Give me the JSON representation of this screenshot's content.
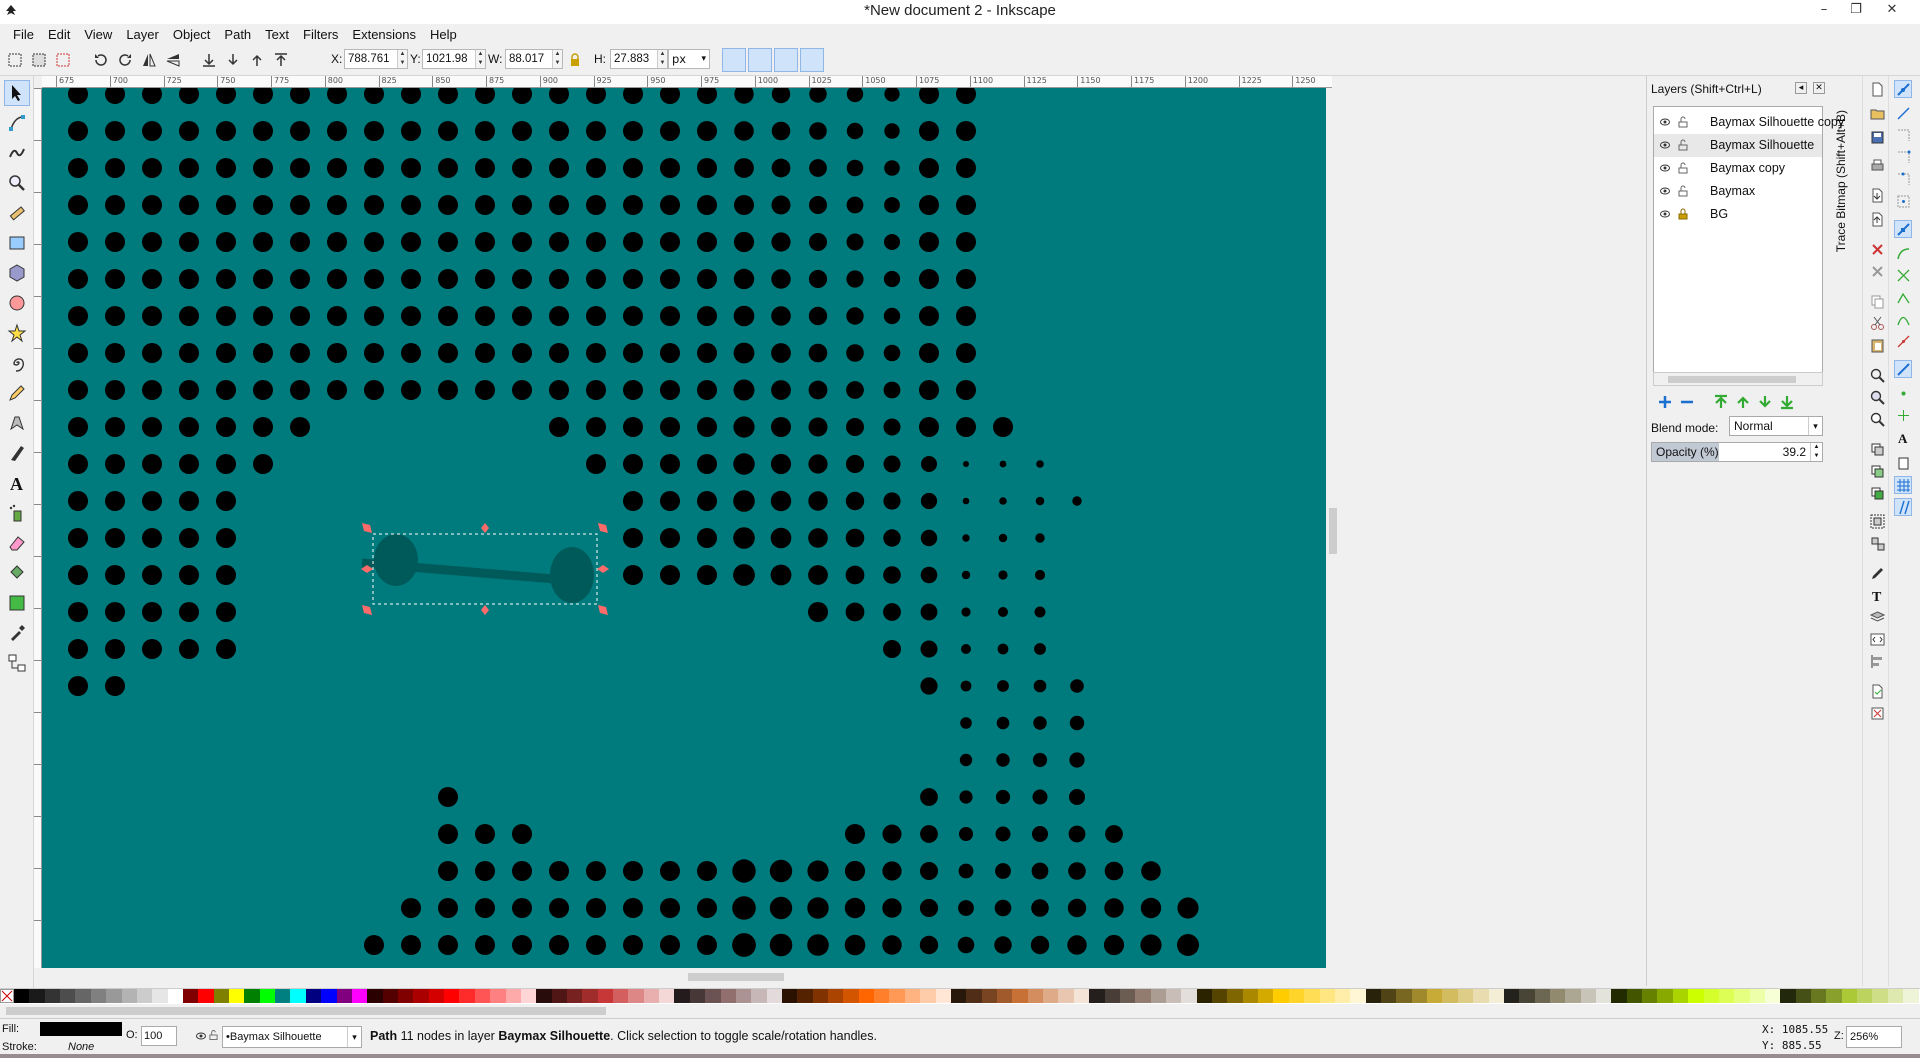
{
  "window": {
    "title": "*New document 2 - Inkscape",
    "controls": [
      "–",
      "❐",
      "✕"
    ]
  },
  "menu": [
    "File",
    "Edit",
    "View",
    "Layer",
    "Object",
    "Path",
    "Text",
    "Filters",
    "Extensions",
    "Help"
  ],
  "toolbar": {
    "x_label": "X:",
    "x_value": "788.761",
    "y_label": "Y:",
    "y_value": "1021.98",
    "w_label": "W:",
    "w_value": "88.017",
    "h_label": "H:",
    "h_value": "27.883",
    "unit": "px"
  },
  "ruler": {
    "ticks": [
      "675",
      "700",
      "725",
      "750",
      "775",
      "800",
      "825",
      "850",
      "875",
      "900",
      "925",
      "950",
      "975",
      "1000",
      "1025",
      "1050",
      "1075",
      "1100",
      "1125",
      "1150",
      "1175",
      "1200",
      "1225",
      "1250"
    ]
  },
  "canvas": {
    "background": "#007b7d",
    "dot_color": "#000000",
    "selection_fill": "#005a5a",
    "handle_color": "#ff6a6a"
  },
  "layers_panel": {
    "title": "Layers (Shift+Ctrl+L)",
    "layers": [
      {
        "name": "Baymax Silhouette copy"
      },
      {
        "name": "Baymax Silhouette"
      },
      {
        "name": "Baymax copy"
      },
      {
        "name": "Baymax"
      },
      {
        "name": "BG"
      }
    ],
    "selected_layer": "Baymax Silhouette",
    "blend_mode_label": "Blend mode:",
    "blend_mode": "Normal",
    "opacity_label": "Opacity (%)",
    "opacity_value": "39.2"
  },
  "trace_tab": "Trace Bitmap (Shift+Alt+B)",
  "status": {
    "fill_label": "Fill:",
    "stroke_label": "Stroke:",
    "stroke_value": "None",
    "fill_color": "#000000",
    "opacity_label": "O:",
    "opacity_value": "100",
    "current_layer": "•Baymax Silhouette",
    "message_prefix": "Path",
    "message_nodes": " 11 nodes in layer ",
    "message_layer": "Baymax Silhouette",
    "message_suffix": ". Click selection to toggle scale/rotation handles.",
    "coord_x": "X: 1085.55",
    "coord_y": "Y:  885.55",
    "zoom_label": "Z:",
    "zoom_value": "256%"
  },
  "palette": [
    "#000000",
    "#1a1a1a",
    "#333333",
    "#4d4d4d",
    "#666666",
    "#808080",
    "#999999",
    "#b3b3b3",
    "#cccccc",
    "#e6e6e6",
    "#ffffff",
    "#800000",
    "#ff0000",
    "#808000",
    "#ffff00",
    "#008000",
    "#00ff00",
    "#008080",
    "#00ffff",
    "#000080",
    "#0000ff",
    "#800080",
    "#ff00ff",
    "#2b0000",
    "#550000",
    "#800000",
    "#aa0000",
    "#d40000",
    "#ff0000",
    "#ff2a2a",
    "#ff5555",
    "#ff8080",
    "#ffaaaa",
    "#ffd5d5",
    "#280b0b",
    "#501616",
    "#782121",
    "#a02c2c",
    "#c83737",
    "#d35f5f",
    "#de8787",
    "#e9afaf",
    "#f4d7d7",
    "#241c1c",
    "#483737",
    "#6c5353",
    "#916f6f",
    "#ac9393",
    "#c8b7b7",
    "#e3dbdb",
    "#2b1100",
    "#552200",
    "#803300",
    "#aa4400",
    "#d45500",
    "#ff6600",
    "#ff7f2a",
    "#ff9955",
    "#ffb380",
    "#ffccaa",
    "#ffe6d5",
    "#28170b",
    "#502d16",
    "#784421",
    "#a05a2c",
    "#c87137",
    "#d38d5f",
    "#deaa87",
    "#e9c6af",
    "#f4e3d7",
    "#241f1c",
    "#483e37",
    "#6c5d53",
    "#917c6f",
    "#ac9d93",
    "#c8beb7",
    "#e3dedb",
    "#2b2200",
    "#554400",
    "#806600",
    "#aa8800",
    "#d4aa00",
    "#ffcc00",
    "#ffd42a",
    "#ffdd55",
    "#ffe680",
    "#ffeeaa",
    "#fff6d5",
    "#28220b",
    "#504416",
    "#786721",
    "#a0892c",
    "#c8ab37",
    "#d3bc5f",
    "#decd87",
    "#e9ddaf",
    "#f4eed7",
    "#24221c",
    "#484537",
    "#6c6753",
    "#918a6f",
    "#aca793",
    "#c8c4b7",
    "#e3e2db",
    "#222b00",
    "#445500",
    "#668000",
    "#88aa00",
    "#aad400",
    "#ccff00",
    "#d4ff2a",
    "#ddff55",
    "#e5ff80",
    "#eeffaa",
    "#f6ffd5",
    "#22280b",
    "#445016",
    "#677821",
    "#89a02c",
    "#abc837",
    "#bcd35f",
    "#cdde87",
    "#dde9af",
    "#eef4d7"
  ]
}
